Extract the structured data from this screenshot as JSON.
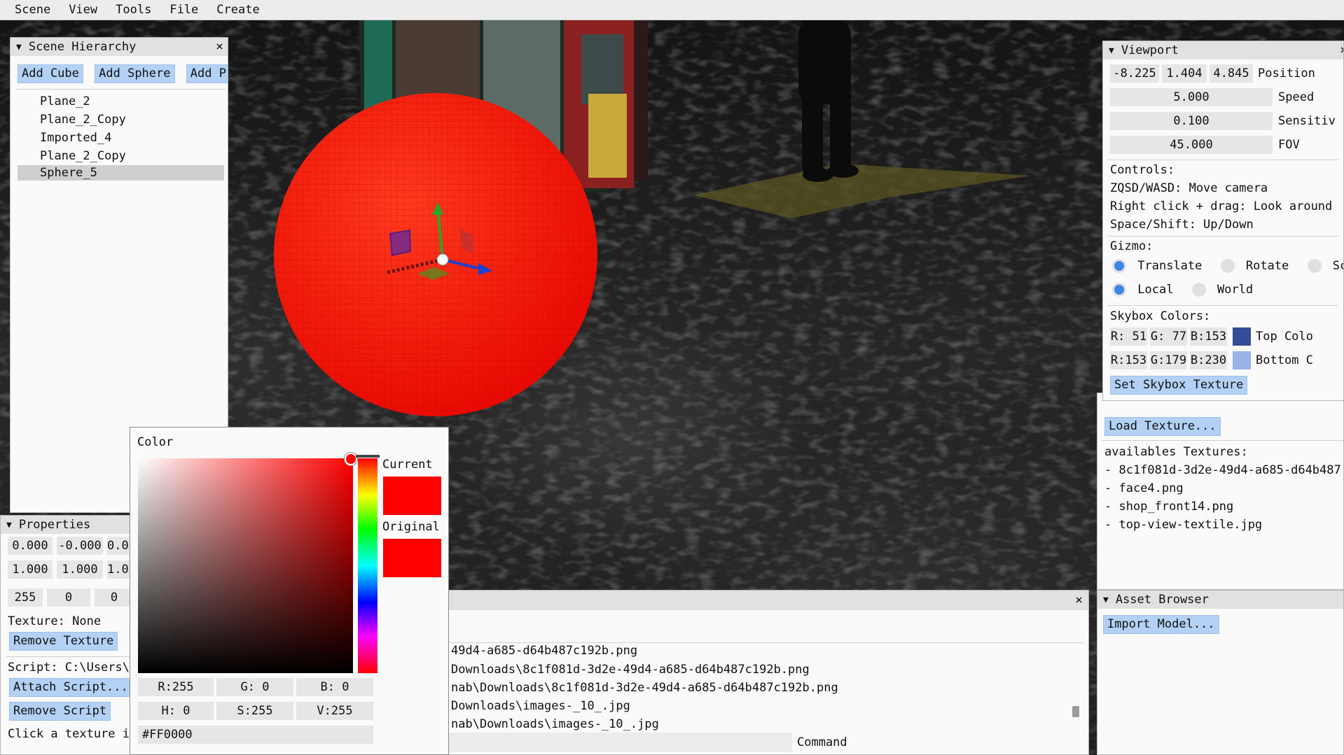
{
  "menu": [
    "Scene",
    "View",
    "Tools",
    "File",
    "Create"
  ],
  "hierarchy": {
    "title": "Scene Hierarchy",
    "close": "×",
    "buttons": [
      "Add Cube",
      "Add Sphere",
      "Add P"
    ],
    "items": [
      "Plane_2",
      "Plane_2_Copy",
      "Imported_4",
      "Plane_2_Copy",
      "Sphere_5"
    ],
    "selected_index": 4
  },
  "properties": {
    "title": "Properties",
    "row1": [
      "0.000",
      "-0.000",
      "0.0"
    ],
    "row2": [
      "1.000",
      "1.000",
      "1.0"
    ],
    "row3": [
      "255",
      "0",
      "0"
    ],
    "texture_label": "Texture: None",
    "remove_texture": "Remove Texture",
    "script_label": "Script: C:\\Users\\",
    "attach_script": "Attach Script...",
    "remove_script": "Remove Script",
    "hint": "Click a texture i"
  },
  "color_picker": {
    "title": "Color",
    "current_label": "Current",
    "original_label": "Original",
    "current_color": "#FF0000",
    "original_color": "#FF0000",
    "rgb": [
      "R:255",
      "G:  0",
      "B:  0"
    ],
    "hsv": [
      "H:  0",
      "S:255",
      "V:255"
    ],
    "hex": "#FF0000"
  },
  "viewport": {
    "title": "Viewport",
    "close": "×",
    "position": [
      "-8.225",
      "1.404",
      "4.845"
    ],
    "position_label": "Position",
    "speed": "5.000",
    "speed_label": "Speed",
    "sensitivity": "0.100",
    "sensitivity_label": "Sensitiv",
    "fov": "45.000",
    "fov_label": "FOV",
    "controls_title": "Controls:",
    "controls": [
      "ZQSD/WASD: Move camera",
      "Right click + drag: Look around",
      "Space/Shift: Up/Down"
    ],
    "gizmo_title": "Gizmo:",
    "gizmo_modes": [
      "Translate",
      "Rotate",
      "Scal"
    ],
    "gizmo_spaces": [
      "Local",
      "World"
    ],
    "skybox_title": "Skybox Colors:",
    "top_rgb": [
      "R: 51",
      "G: 77",
      "B:153"
    ],
    "top_label": "Top Colo",
    "top_color": "#334d99",
    "bottom_rgb": [
      "R:153",
      "G:179",
      "B:230"
    ],
    "bottom_label": "Bottom C",
    "bottom_color": "#99b3e6",
    "set_skybox": "Set Skybox Texture"
  },
  "textures": {
    "load_button": "Load Texture...",
    "title": "availables Textures:",
    "items": [
      "- 8c1f081d-3d2e-49d4-a685-d64b487",
      "- face4.png",
      "- shop_front14.png",
      "- top-view-textile.jpg"
    ]
  },
  "asset_browser": {
    "title": "Asset Browser",
    "import_button": "Import Model..."
  },
  "console": {
    "close": "×",
    "lines": [
      "49d4-a685-d64b487c192b.png",
      "Downloads\\8c1f081d-3d2e-49d4-a685-d64b487c192b.png",
      "nab\\Downloads\\8c1f081d-3d2e-49d4-a685-d64b487c192b.png",
      "Downloads\\images-_10_.jpg",
      "nab\\Downloads\\images-_10_.jpg"
    ],
    "command_label": "Command"
  },
  "scene_colors": {
    "sphere": "#ff1a0a",
    "floor_plane": "#5a5420"
  }
}
